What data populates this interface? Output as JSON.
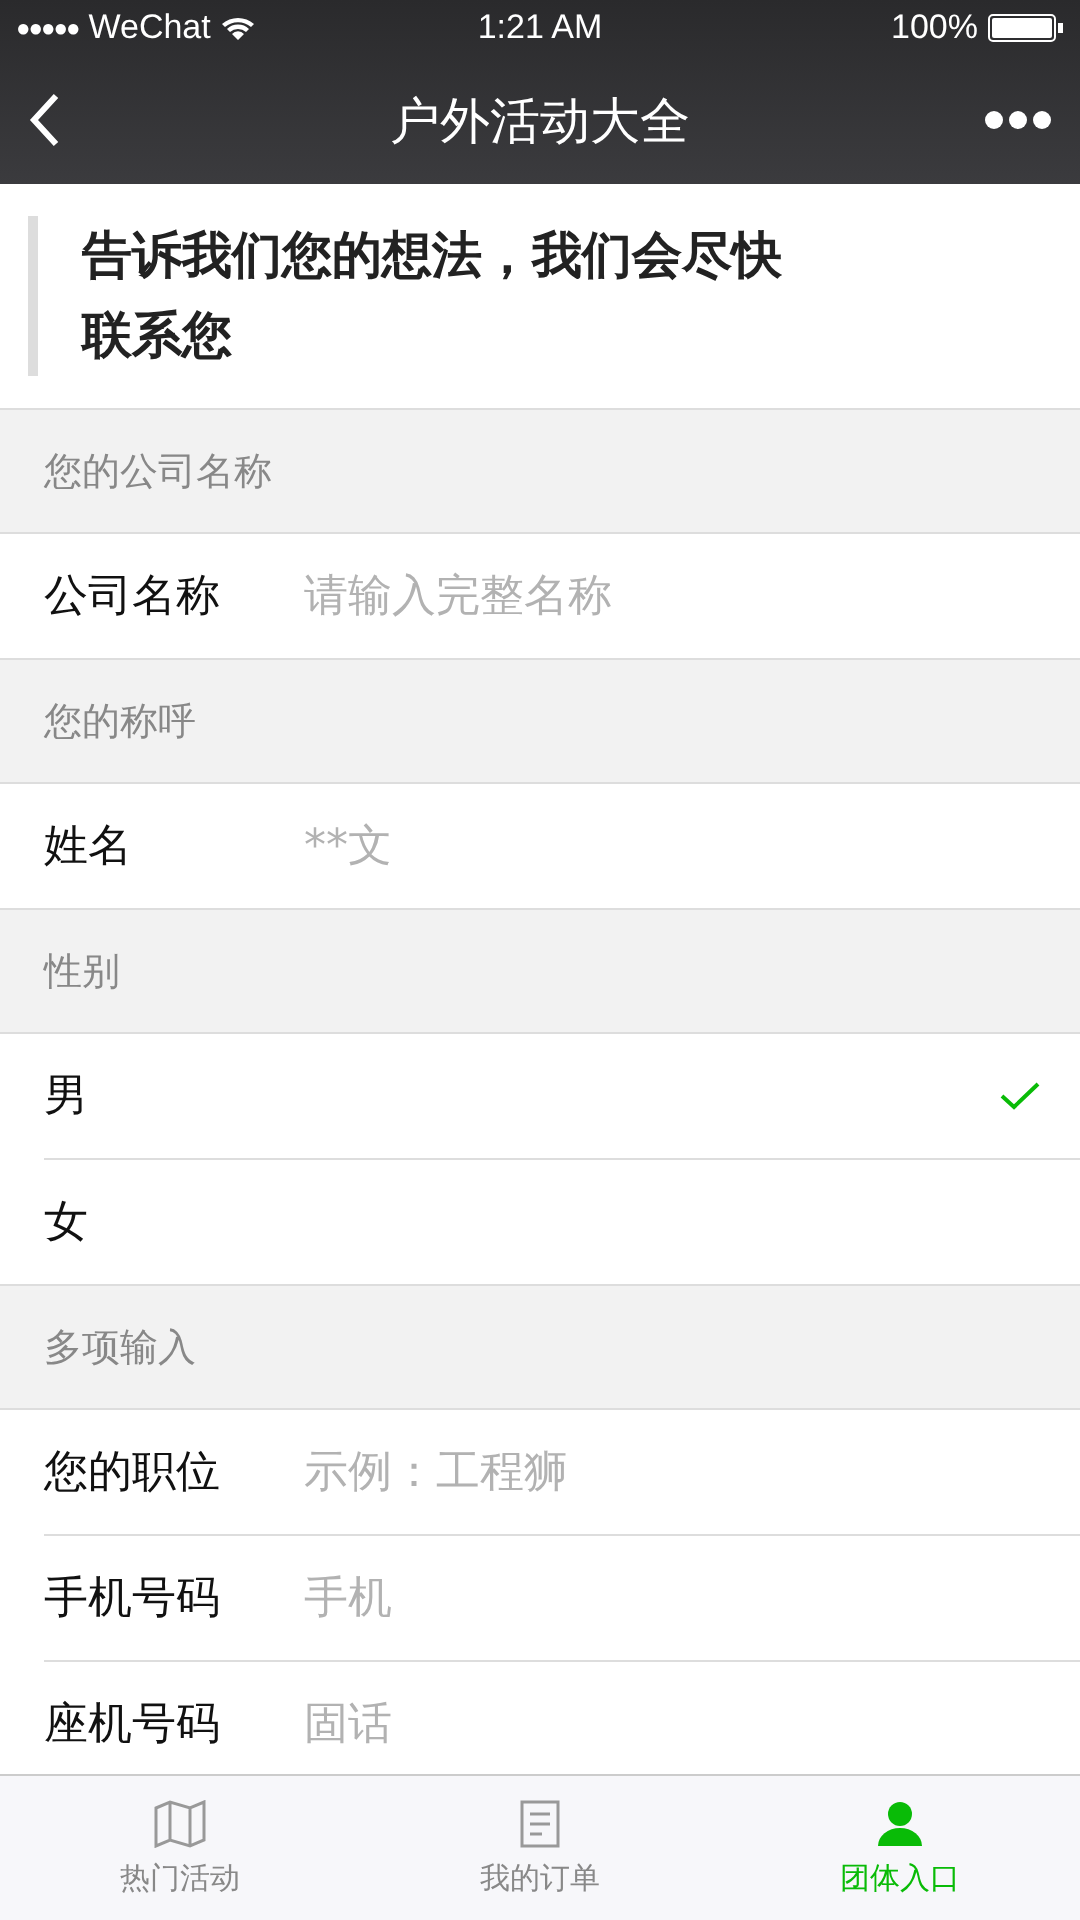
{
  "status_bar": {
    "signal": "●●●●●",
    "carrier": "WeChat",
    "time": "1:21 AM",
    "battery": "100%"
  },
  "nav_bar": {
    "title": "户外活动大全"
  },
  "notice": "告诉我们您的想法，我们会尽快联系您",
  "sections": [
    {
      "header": "您的公司名称",
      "rows": [
        {
          "kind": "input",
          "label": "公司名称",
          "placeholder": "请输入完整名称"
        }
      ]
    },
    {
      "header": "您的称呼",
      "rows": [
        {
          "kind": "input",
          "label": "姓名",
          "placeholder": "**文"
        }
      ]
    },
    {
      "header": "性别",
      "rows": [
        {
          "kind": "radio",
          "label": "男",
          "selected": true
        },
        {
          "kind": "radio",
          "label": "女",
          "selected": false
        }
      ]
    },
    {
      "header": "多项输入",
      "rows": [
        {
          "kind": "input",
          "label": "您的职位",
          "placeholder": "示例：工程狮"
        },
        {
          "kind": "input",
          "label": "手机号码",
          "placeholder": "手机"
        },
        {
          "kind": "input",
          "label": "座机号码",
          "placeholder": "固话"
        }
      ]
    }
  ],
  "tab_bar": [
    {
      "label": "热门活动",
      "kind": "map",
      "selected": false
    },
    {
      "label": "我的订单",
      "kind": "doc",
      "selected": false
    },
    {
      "label": "团体入口",
      "kind": "person",
      "selected": true
    }
  ]
}
